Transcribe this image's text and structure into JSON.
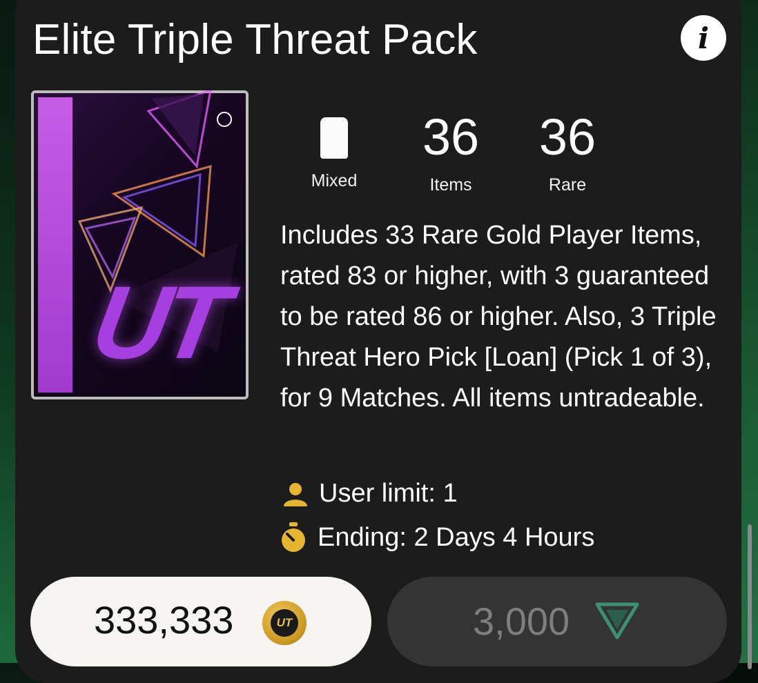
{
  "pack": {
    "title": "Elite Triple Threat Pack",
    "info_icon": "i"
  },
  "stats": {
    "type_label": "Mixed",
    "items_value": "36",
    "items_label": "Items",
    "rare_value": "36",
    "rare_label": "Rare"
  },
  "description": "Includes 33 Rare Gold Player Items, rated 83 or higher, with 3 guaranteed to be rated 86 or higher. Also, 3 Triple Threat Hero Pick [Loan] (Pick 1 of 3), for 9 Matches. All items untradeable.",
  "meta": {
    "user_limit": "User limit: 1",
    "ending": "Ending: 2 Days 4 Hours"
  },
  "purchase": {
    "coins_price": "333,333",
    "coins_icon_text": "UT",
    "points_price": "3,000"
  },
  "pack_art": {
    "logo_text": "UT"
  },
  "colors": {
    "card_bg": "#1c1c1c",
    "accent_gold": "#e5b431",
    "coin_button_bg": "#f7f5f1",
    "points_button_bg": "#343434",
    "points_icon": "#3d8f76"
  }
}
